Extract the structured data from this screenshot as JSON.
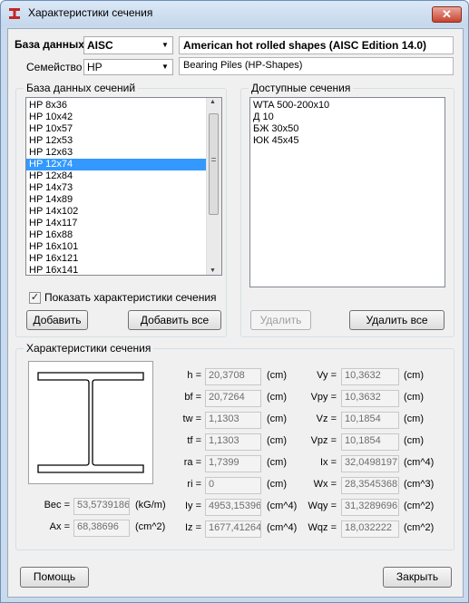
{
  "window": {
    "title": "Характеристики сечения",
    "close_label": "✕"
  },
  "database": {
    "label": "База данных",
    "value": "AISC",
    "description": "American hot rolled shapes (AISC Edition 14.0)"
  },
  "family": {
    "label": "Семейство",
    "value": "HP",
    "description": "Bearing Piles (HP-Shapes)"
  },
  "db_sections": {
    "title": "База данных сечений",
    "items": [
      "HP 8x36",
      "HP 10x42",
      "HP 10x57",
      "HP 12x53",
      "HP 12x63",
      "HP 12x74",
      "HP 12x84",
      "HP 14x73",
      "HP 14x89",
      "HP 14x102",
      "HP 14x117",
      "HP 16x88",
      "HP 16x101",
      "HP 16x121",
      "HP 16x141"
    ],
    "selected_index": 5,
    "show_props_label": "Показать характеристики сечения",
    "show_props_checked": true,
    "add_label": "Добавить",
    "add_all_label": "Добавить все"
  },
  "available": {
    "title": "Доступные сечения",
    "items": [
      "WTA 500-200x10",
      "Д 10",
      "БЖ 30x50",
      "ЮК 45x45"
    ],
    "delete_label": "Удалить",
    "delete_all_label": "Удалить все"
  },
  "props": {
    "title": "Характеристики сечения",
    "col1": [
      {
        "name": "h",
        "label": "h =",
        "value": "20,3708",
        "unit": "(cm)"
      },
      {
        "name": "bf",
        "label": "bf =",
        "value": "20,7264",
        "unit": "(cm)"
      },
      {
        "name": "tw",
        "label": "tw =",
        "value": "1,1303",
        "unit": "(cm)"
      },
      {
        "name": "tf",
        "label": "tf =",
        "value": "1,1303",
        "unit": "(cm)"
      },
      {
        "name": "ra",
        "label": "ra =",
        "value": "1,7399",
        "unit": "(cm)"
      },
      {
        "name": "ri",
        "label": "ri =",
        "value": "0",
        "unit": "(cm)"
      },
      {
        "name": "iy",
        "label": "Iy =",
        "value": "4953,15396",
        "unit": "(cm^4)"
      },
      {
        "name": "iz",
        "label": "Iz =",
        "value": "1677,41264",
        "unit": "(cm^4)"
      }
    ],
    "col2": [
      {
        "name": "vy",
        "label": "Vy =",
        "value": "10,3632",
        "unit": "(cm)"
      },
      {
        "name": "vpy",
        "label": "Vpy =",
        "value": "10,3632",
        "unit": "(cm)"
      },
      {
        "name": "vz",
        "label": "Vz =",
        "value": "10,1854",
        "unit": "(cm)"
      },
      {
        "name": "vpz",
        "label": "Vpz =",
        "value": "10,1854",
        "unit": "(cm)"
      },
      {
        "name": "ix",
        "label": "Ix =",
        "value": "32,0498197",
        "unit": "(cm^4)"
      },
      {
        "name": "wx",
        "label": "Wx =",
        "value": "28,3545368",
        "unit": "(cm^3)"
      },
      {
        "name": "wqy",
        "label": "Wqy =",
        "value": "31,3289696",
        "unit": "(cm^2)"
      },
      {
        "name": "wqz",
        "label": "Wqz =",
        "value": "18,032222",
        "unit": "(cm^2)"
      }
    ],
    "bec": {
      "label": "Bec =",
      "value": "53,5739186",
      "unit": "(kG/m)"
    },
    "ax": {
      "label": "Ax =",
      "value": "68,38696",
      "unit": "(cm^2)"
    }
  },
  "footer": {
    "help_label": "Помощь",
    "close_label": "Закрыть"
  }
}
